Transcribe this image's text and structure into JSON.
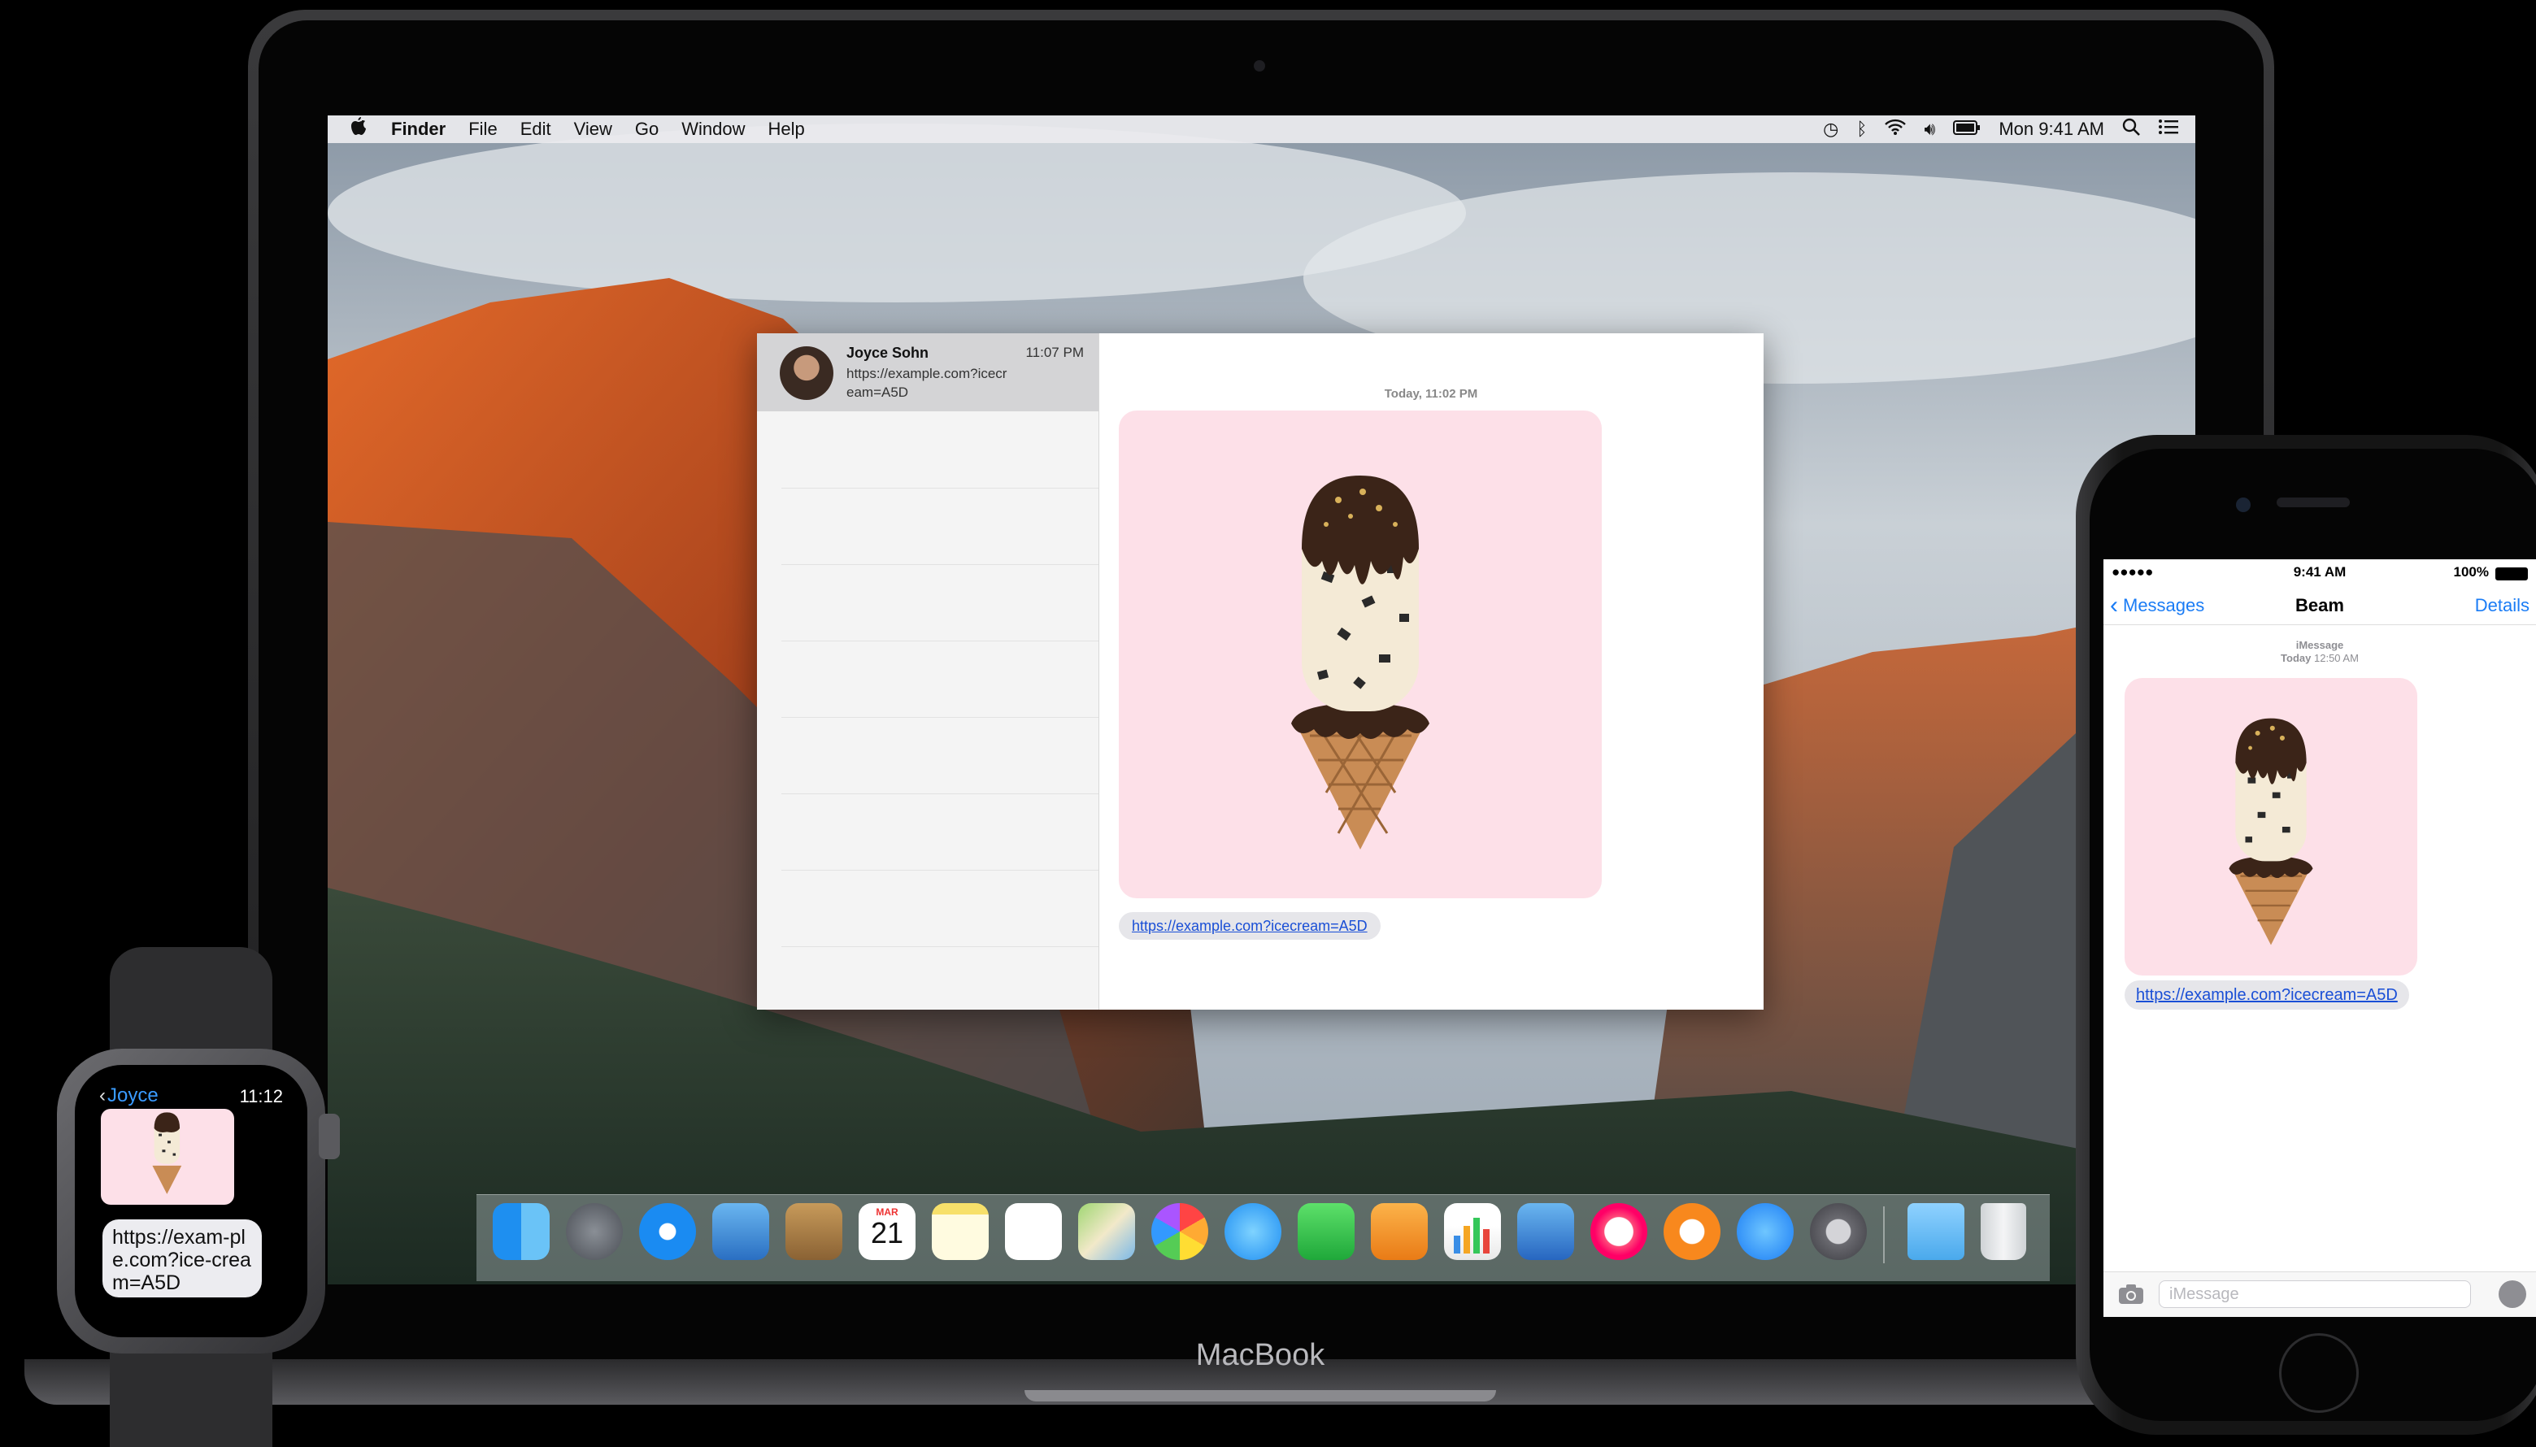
{
  "mac": {
    "menubar": {
      "apple": "",
      "app_name": "Finder",
      "menus": [
        "File",
        "Edit",
        "View",
        "Go",
        "Window",
        "Help"
      ],
      "clock": "Mon 9:41 AM"
    },
    "messages": {
      "conversation": {
        "name": "Joyce Sohn",
        "time": "11:07 PM",
        "preview": "https://example.com?icecream=A5D"
      },
      "timestamp": "Today, 11:02 PM",
      "link": "https://example.com?icecream=A5D"
    },
    "dock_icons": [
      "finder-icon",
      "launchpad-icon",
      "safari-icon",
      "mail-icon",
      "contacts-icon",
      "calendar-icon",
      "notes-icon",
      "reminders-icon",
      "maps-icon",
      "photos-icon",
      "messages-icon",
      "facetime-icon",
      "pages-icon",
      "numbers-icon",
      "keynote-icon",
      "itunes-icon",
      "ibooks-icon",
      "app-store-icon",
      "system-preferences-icon",
      "downloads-icon",
      "trash-icon"
    ],
    "calendar": {
      "month": "MAR",
      "day": "21"
    },
    "brand": "MacBook"
  },
  "iphone": {
    "carrier": "●●●●● ",
    "time": "9:41 AM",
    "battery": "100%",
    "back_label": "Messages",
    "title": "Beam",
    "details_label": "Details",
    "service": "iMessage",
    "timestamp_day": "Today",
    "timestamp_time": "12:50 AM",
    "link": "https://example.com?icecream=A5D",
    "input_placeholder": "iMessage"
  },
  "watch": {
    "back_label": "Joyce",
    "time": "11:12",
    "message": "https://exam-ple.com?ice-cream=A5D"
  },
  "colors": {
    "link_blue": "#1a4fd6",
    "ios_blue": "#1a7cf5",
    "bubble_pink": "#fde0e8",
    "bubble_gray": "#e6e6ea"
  }
}
